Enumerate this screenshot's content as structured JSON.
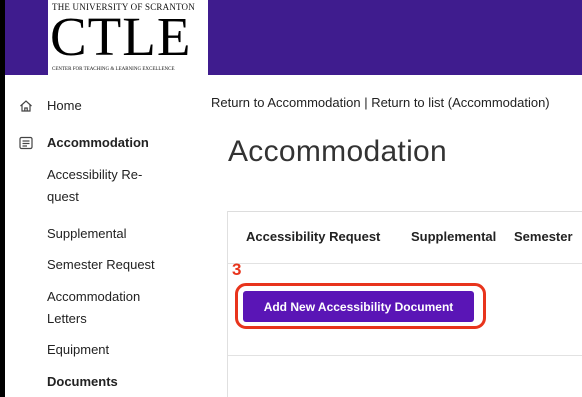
{
  "logo": {
    "university": "THE UNIVERSITY OF SCRANTON",
    "acronym": "CTLE",
    "tagline": "CENTER FOR TEACHING & LEARNING EXCELLENCE"
  },
  "sidebar": {
    "items": [
      {
        "label": "Home",
        "icon": "home-icon"
      },
      {
        "label": "Accommodation",
        "icon": "list-icon"
      }
    ],
    "subitems": [
      {
        "label": "Accessibility Re-quest"
      },
      {
        "label": "Supplemental"
      },
      {
        "label": "Semester Request"
      },
      {
        "label": "Accommodation Letters"
      },
      {
        "label": "Equipment"
      },
      {
        "label": "Documents"
      }
    ]
  },
  "breadcrumb": {
    "back_label": "Return to Accommodation",
    "separator": " | ",
    "list_label": "Return to list (Accommodation)"
  },
  "main": {
    "title": "Accommodation",
    "tabs": [
      {
        "label": "Accessibility Request"
      },
      {
        "label": "Supplemental"
      },
      {
        "label": "Semester"
      }
    ],
    "step_number": "3",
    "add_button_label": "Add New Accessibility Document"
  },
  "colors": {
    "header_purple": "#3f1c8e",
    "button_purple": "#5a15b6",
    "annotation_red": "#e8341c"
  }
}
